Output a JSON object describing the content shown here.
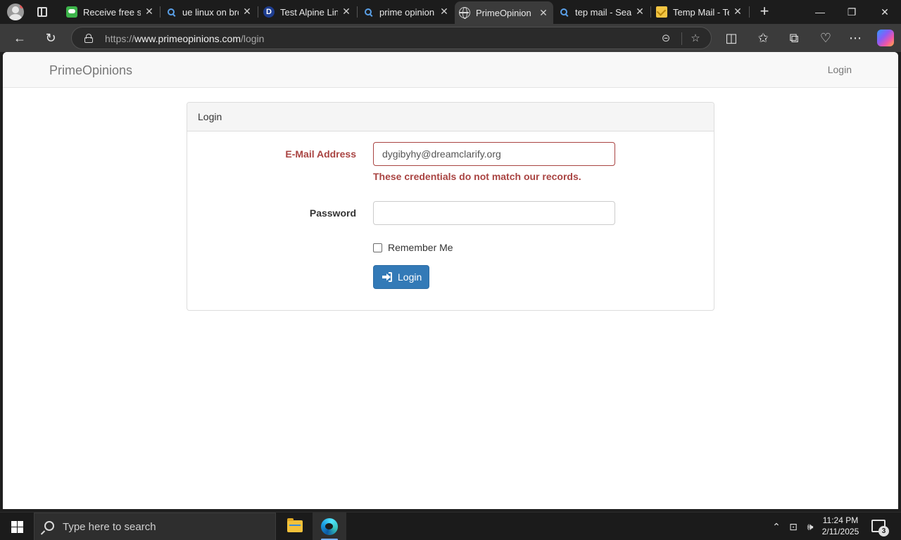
{
  "browser": {
    "tabs": [
      {
        "title": "Receive free sms",
        "favicon": "message-icon"
      },
      {
        "title": "ue linux on browser",
        "favicon": "search-icon"
      },
      {
        "title": "Test Alpine Linux",
        "favicon": "d-logo-icon"
      },
      {
        "title": "prime opinion",
        "favicon": "search-icon"
      },
      {
        "title": "PrimeOpinion",
        "favicon": "globe-icon",
        "active": true
      },
      {
        "title": "tep mail - Search",
        "favicon": "search-icon"
      },
      {
        "title": "Temp Mail - Temporary",
        "favicon": "mail-icon"
      }
    ],
    "address": {
      "scheme": "https://",
      "host": "www.primeopinions.com",
      "path": "/login"
    }
  },
  "page": {
    "brand": "PrimeOpinions",
    "nav_login": "Login",
    "panel_title": "Login",
    "email_label": "E-Mail Address",
    "email_value": "dygibyhy@dreamclarify.org",
    "email_error": "These credentials do not match our records.",
    "password_label": "Password",
    "password_value": "",
    "remember_label": "Remember Me",
    "login_button": "Login",
    "colors": {
      "primary": "#337ab7",
      "error": "#a94442",
      "navbar_bg": "#f8f8f8"
    }
  },
  "taskbar": {
    "search_placeholder": "Type here to search",
    "time": "11:24 PM",
    "date": "2/11/2025",
    "notification_count": "3"
  }
}
